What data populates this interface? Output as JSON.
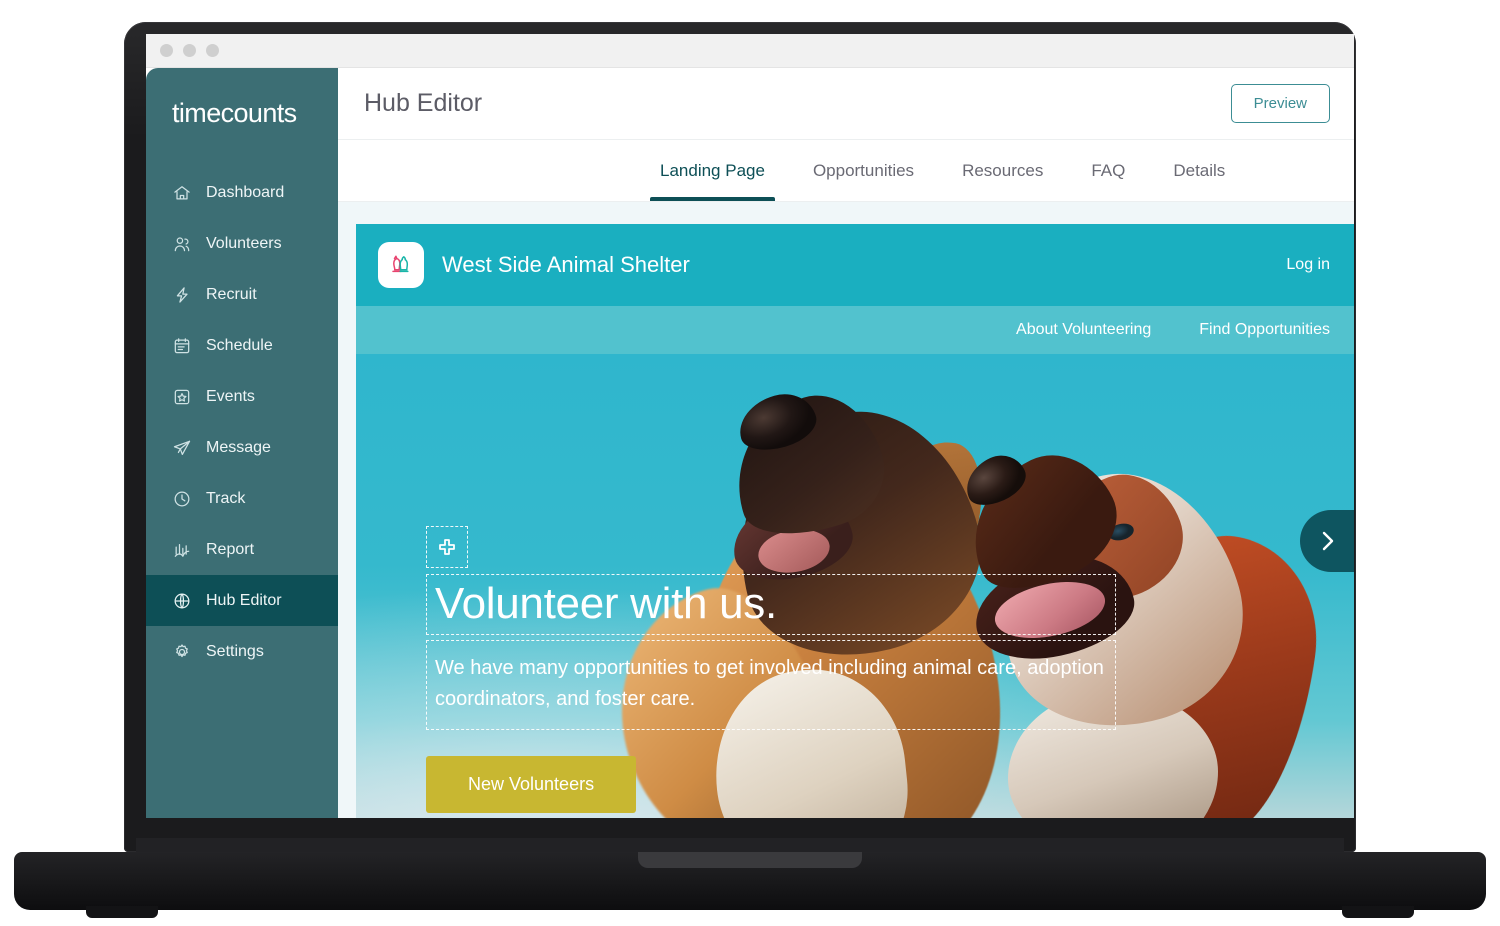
{
  "browser": {
    "dots": [
      "close-dot",
      "minimize-dot",
      "maximize-dot"
    ]
  },
  "sidebar": {
    "brand": "timecounts",
    "items": [
      {
        "label": "Dashboard",
        "icon": "home-icon",
        "active": false
      },
      {
        "label": "Volunteers",
        "icon": "people-icon",
        "active": false
      },
      {
        "label": "Recruit",
        "icon": "lightning-icon",
        "active": false
      },
      {
        "label": "Schedule",
        "icon": "calendar-icon",
        "active": false
      },
      {
        "label": "Events",
        "icon": "star-box-icon",
        "active": false
      },
      {
        "label": "Message",
        "icon": "paper-plane-icon",
        "active": false
      },
      {
        "label": "Track",
        "icon": "clock-icon",
        "active": false
      },
      {
        "label": "Report",
        "icon": "bar-chart-icon",
        "active": false
      },
      {
        "label": "Hub Editor",
        "icon": "globe-icon",
        "active": true
      },
      {
        "label": "Settings",
        "icon": "gear-icon",
        "active": false
      }
    ]
  },
  "topbar": {
    "title": "Hub Editor",
    "preview_label": "Preview"
  },
  "tabs": [
    {
      "label": "Landing Page",
      "active": true
    },
    {
      "label": "Opportunities",
      "active": false
    },
    {
      "label": "Resources",
      "active": false
    },
    {
      "label": "FAQ",
      "active": false
    },
    {
      "label": "Details",
      "active": false
    }
  ],
  "hub": {
    "logo_icon": "cat-and-dog-logo",
    "org_name": "West Side Animal Shelter",
    "login_label": "Log in",
    "nav": [
      {
        "label": "About Volunteering"
      },
      {
        "label": "Find Opportunities"
      }
    ],
    "hero": {
      "add_block_icon": "add-block-icon",
      "title": "Volunteer with us.",
      "subtitle": "We have many opportunities to get involved including animal care, adoption coordinators, and foster care.",
      "cta_label": "New Volunteers",
      "next_icon": "chevron-right-icon"
    }
  },
  "colors": {
    "sidebar": "#3c6e74",
    "sidebar_active": "#0d4f56",
    "hub_header": "#1aafc0",
    "hub_nav": "#52c2ce",
    "cta": "#c8b731",
    "tab_active": "#0d4f56",
    "preview_border": "#3c8d94",
    "canvas": "#f0f7f9"
  }
}
